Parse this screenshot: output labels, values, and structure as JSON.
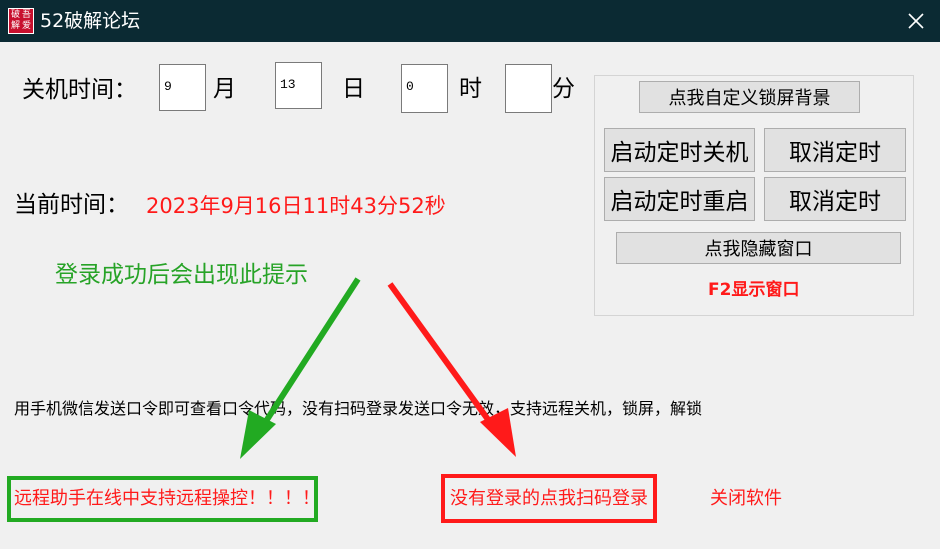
{
  "window": {
    "title": "52破解论坛",
    "icon_chars": [
      "破",
      "吾",
      "解",
      "爱"
    ]
  },
  "shutdown": {
    "label": "关机时间：",
    "month_value": "9",
    "month_unit": "月",
    "day_value": "13",
    "day_unit": "日",
    "hour_value": "0",
    "hour_unit": "时",
    "minute_value": "",
    "minute_unit": "分"
  },
  "current_time": {
    "label": "当前时间：",
    "value": "2023年9月16日11时43分52秒"
  },
  "panel": {
    "custom_bg_button": "点我自定义锁屏背景",
    "start_shutdown_button": "启动定时关机",
    "cancel_timer_button_1": "取消定时",
    "start_restart_button": "启动定时重启",
    "cancel_timer_button_2": "取消定时",
    "hide_window_button": "点我隐藏窗口",
    "f2_hint": "F2显示窗口"
  },
  "annotation": {
    "login_success_hint": "登录成功后会出现此提示"
  },
  "info_text": "用手机微信发送口令即可查看口令代码，没有扫码登录发送口令无效，支持远程关机，锁屏，解锁",
  "bottom": {
    "remote_support_text": "远程助手在线中支持远程操控！！！！",
    "scan_login_link": "没有登录的点我扫码登录",
    "close_software_link": "关闭软件"
  },
  "colors": {
    "titlebar": "#0b2a33",
    "red": "#ff1a1a",
    "green": "#27a327"
  }
}
